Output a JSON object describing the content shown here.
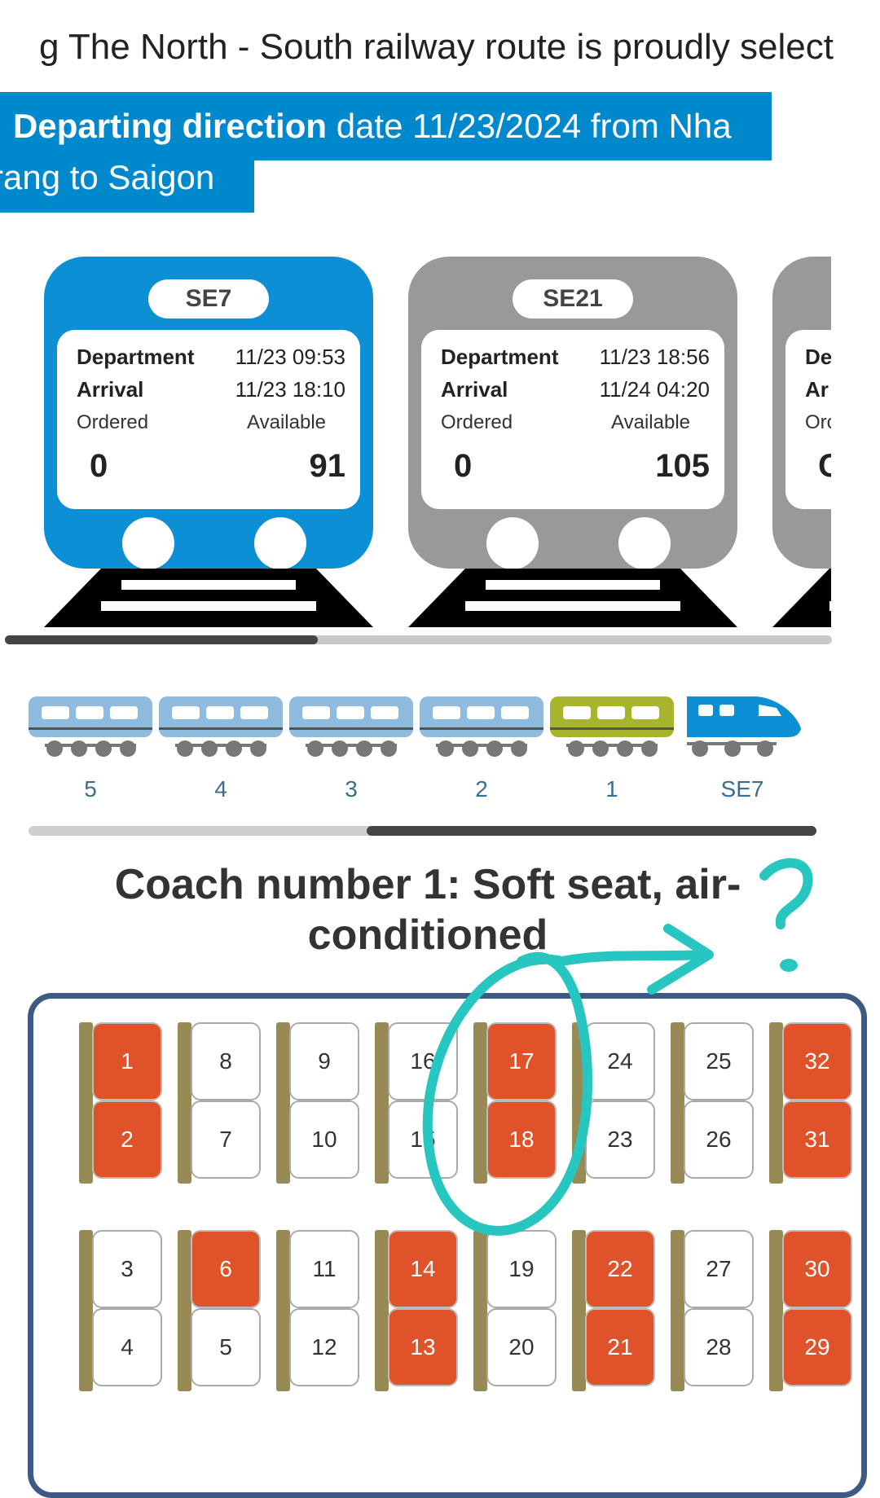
{
  "marquee": "g The North - South railway route is proudly select",
  "direction": {
    "bold": "Departing direction",
    "line1_rest": " date 11/23/2024 from Nha",
    "line2": "rang to Saigon"
  },
  "trains": [
    {
      "name": "SE7",
      "active": true,
      "dep_label": "Department",
      "dep": "11/23 09:53",
      "arr_label": "Arrival",
      "arr": "11/23 18:10",
      "ordered_label": "Ordered",
      "available_label": "Available",
      "ordered": "0",
      "available": "91"
    },
    {
      "name": "SE21",
      "active": false,
      "dep_label": "Department",
      "dep": "11/23 18:56",
      "arr_label": "Arrival",
      "arr": "11/24 04:20",
      "ordered_label": "Ordered",
      "available_label": "Available",
      "ordered": "0",
      "available": "105"
    },
    {
      "name": "",
      "active": false,
      "dep_label": "De",
      "dep": "",
      "arr_label": "Ar",
      "arr": "",
      "ordered_label": "Orc",
      "available_label": "",
      "ordered": "C",
      "available": ""
    }
  ],
  "coaches": [
    {
      "label": "5",
      "type": "car",
      "color": "#8fbcde"
    },
    {
      "label": "4",
      "type": "car",
      "color": "#8fbcde"
    },
    {
      "label": "3",
      "type": "car",
      "color": "#8fbcde"
    },
    {
      "label": "2",
      "type": "car",
      "color": "#8fbcde"
    },
    {
      "label": "1",
      "type": "car",
      "color": "#a8b52c"
    },
    {
      "label": "SE7",
      "type": "engine",
      "color": "#0d8fd6"
    }
  ],
  "coach_title": "Coach number 1: Soft seat, air-conditioned",
  "seat_columns": [
    {
      "top": [
        {
          "n": "1",
          "taken": true
        },
        {
          "n": "2",
          "taken": true
        }
      ],
      "bottom": [
        {
          "n": "3",
          "taken": false
        },
        {
          "n": "4",
          "taken": false
        }
      ]
    },
    {
      "top": [
        {
          "n": "8",
          "taken": false
        },
        {
          "n": "7",
          "taken": false
        }
      ],
      "bottom": [
        {
          "n": "6",
          "taken": true
        },
        {
          "n": "5",
          "taken": false
        }
      ]
    },
    {
      "top": [
        {
          "n": "9",
          "taken": false
        },
        {
          "n": "10",
          "taken": false
        }
      ],
      "bottom": [
        {
          "n": "11",
          "taken": false
        },
        {
          "n": "12",
          "taken": false
        }
      ]
    },
    {
      "top": [
        {
          "n": "16",
          "taken": false
        },
        {
          "n": "15",
          "taken": false
        }
      ],
      "bottom": [
        {
          "n": "14",
          "taken": true
        },
        {
          "n": "13",
          "taken": true
        }
      ]
    },
    {
      "top": [
        {
          "n": "17",
          "taken": true
        },
        {
          "n": "18",
          "taken": true
        }
      ],
      "bottom": [
        {
          "n": "19",
          "taken": false
        },
        {
          "n": "20",
          "taken": false
        }
      ]
    },
    {
      "top": [
        {
          "n": "24",
          "taken": false
        },
        {
          "n": "23",
          "taken": false
        }
      ],
      "bottom": [
        {
          "n": "22",
          "taken": true
        },
        {
          "n": "21",
          "taken": true
        }
      ]
    },
    {
      "top": [
        {
          "n": "25",
          "taken": false
        },
        {
          "n": "26",
          "taken": false
        }
      ],
      "bottom": [
        {
          "n": "27",
          "taken": false
        },
        {
          "n": "28",
          "taken": false
        }
      ]
    },
    {
      "top": [
        {
          "n": "32",
          "taken": true
        },
        {
          "n": "31",
          "taken": true
        }
      ],
      "bottom": [
        {
          "n": "30",
          "taken": true
        },
        {
          "n": "29",
          "taken": true
        }
      ]
    }
  ],
  "annotation_mark": "?"
}
